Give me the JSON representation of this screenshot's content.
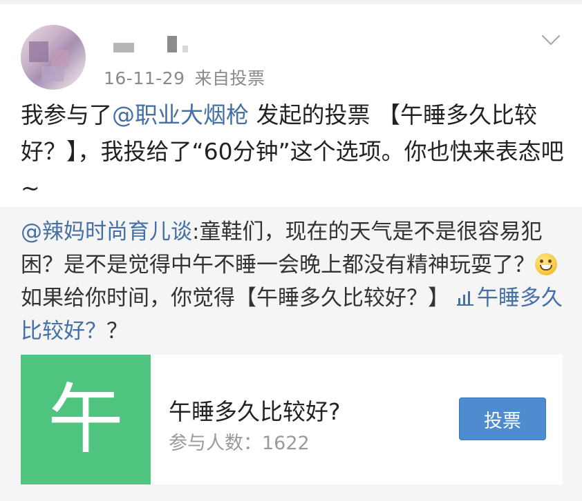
{
  "post": {
    "date": "16-11-29",
    "source": "来自投票",
    "text_prefix": "我参与了",
    "mention": "@职业大烟枪",
    "text_suffix": " 发起的投票 【午睡多久比较好？】，我投给了“60分钟”这个选项。你也快来表态吧~"
  },
  "repost": {
    "mention": "@辣妈时尚育儿谈",
    "text_1": ":童鞋们，现在的天气是不是很容易犯困？是不是觉得中午不睡一会晚上都没有精神玩耍了？",
    "emoji": "smile-emoji",
    "text_2": "如果给你时间，你觉得【午睡多久比较好？】",
    "poll_link": "午睡多久比较好？",
    "text_3": "？"
  },
  "card": {
    "thumb_char": "午",
    "title": "午睡多久比较好?",
    "count": "参与人数：1622",
    "vote_label": "投票"
  },
  "colors": {
    "link": "#4470a6",
    "card_thumb": "#4fc47e",
    "vote_button": "#4e8ccf"
  }
}
